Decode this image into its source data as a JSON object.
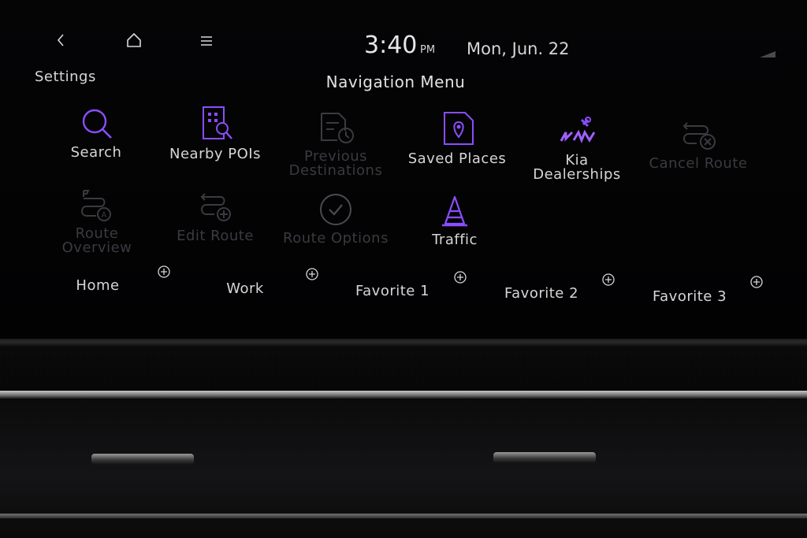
{
  "header": {
    "back_label": "<",
    "time": "3:40",
    "ampm": "PM",
    "date": "Mon, Jun. 22",
    "settings_label": "Settings",
    "title": "Navigation Menu"
  },
  "menu": {
    "items": [
      {
        "label": "Search",
        "icon": "search-icon",
        "enabled": true
      },
      {
        "label": "Nearby POIs",
        "icon": "nearby-pois-icon",
        "enabled": true
      },
      {
        "label1": "Previous",
        "label2": "Destinations",
        "icon": "previous-destinations-icon",
        "enabled": false
      },
      {
        "label": "Saved Places",
        "icon": "saved-places-icon",
        "enabled": true
      },
      {
        "label1": "Kia",
        "label2": "Dealerships",
        "icon": "kia-dealership-icon",
        "enabled": true
      },
      {
        "label": "Cancel Route",
        "icon": "cancel-route-icon",
        "enabled": false
      },
      {
        "label1": "Route",
        "label2": "Overview",
        "icon": "route-overview-icon",
        "enabled": false
      },
      {
        "label": "Edit Route",
        "icon": "edit-route-icon",
        "enabled": false
      },
      {
        "label": "Route Options",
        "icon": "route-options-icon",
        "enabled": false
      },
      {
        "label": "Traffic",
        "icon": "traffic-cone-icon",
        "enabled": true
      }
    ]
  },
  "shortcuts": [
    "Home",
    "Work",
    "Favorite 1",
    "Favorite 2",
    "Favorite 3"
  ],
  "colors": {
    "accent": "#8a4dff",
    "text": "#d6d6d8",
    "disabled": "#3a3a40"
  }
}
